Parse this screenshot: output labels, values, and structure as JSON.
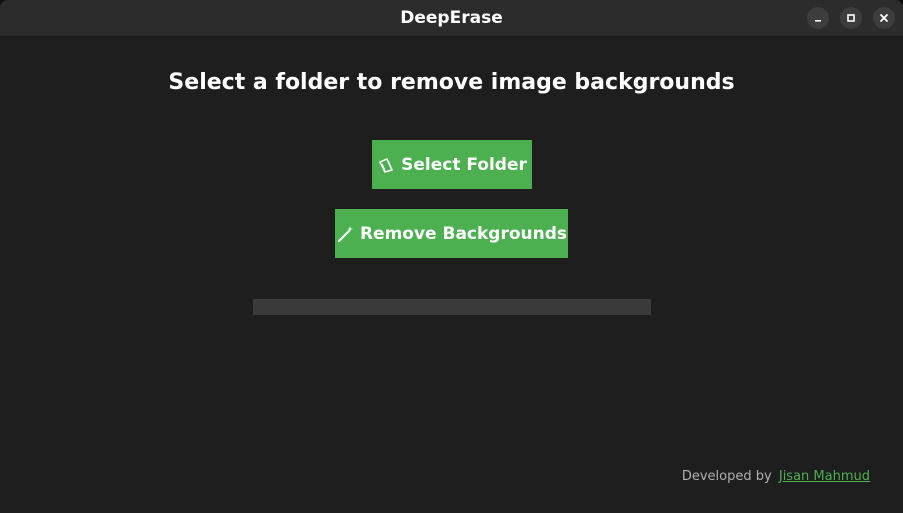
{
  "window": {
    "title": "DeepErase",
    "controls": {
      "minimize": "minimize-icon",
      "maximize": "maximize-icon",
      "close": "close-icon"
    }
  },
  "main": {
    "heading": "Select a folder to remove image backgrounds",
    "select_button": {
      "label": "Select Folder",
      "icon": "folder-icon"
    },
    "remove_button": {
      "label": "Remove Backgrounds",
      "icon": "magic-wand-icon"
    },
    "progress": {
      "value": 0
    }
  },
  "footer": {
    "prefix": "Developed by",
    "link_text": "Jisan Mahmud"
  },
  "colors": {
    "accent": "#4caf50",
    "background": "#1e1e1e",
    "titlebar": "#2c2c2c",
    "progress_track": "#3a3a3a"
  }
}
